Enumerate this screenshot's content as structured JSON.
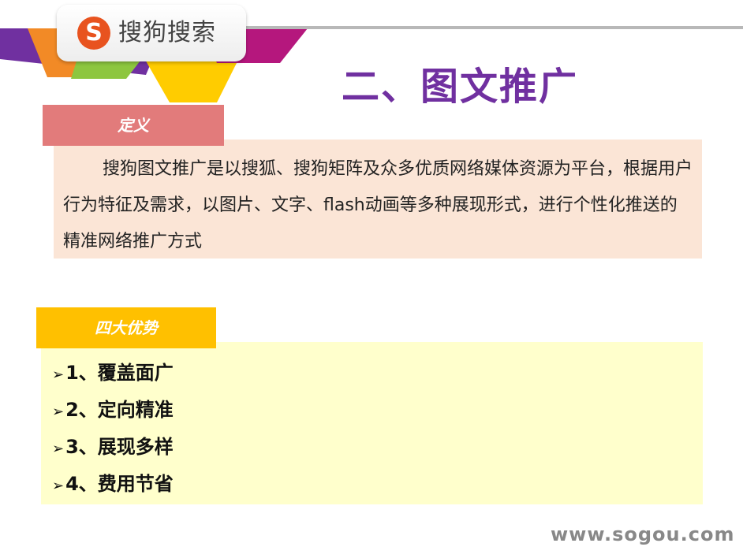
{
  "logo": {
    "mark": "S",
    "text": "搜狗搜索"
  },
  "title": "二、图文推广",
  "definition": {
    "label": "定义",
    "text": "搜狗图文推广是以搜狐、搜狗矩阵及众多优质网络媒体资源为平台，根据用户行为特征及需求，以图片、文字、flash动画等多种展现形式，进行个性化推送的精准网络推广方式"
  },
  "advantages": {
    "label": "四大优势",
    "bullet_glyph": "➢",
    "items": [
      "1、覆盖面广",
      "2、定向精准",
      "3、展现多样",
      "4、费用节省"
    ]
  },
  "footer": {
    "url": "www.sogou.com"
  },
  "colors": {
    "title": "#7030a0",
    "definition_tag": "#e27b7b",
    "definition_box": "#fbe5d6",
    "advantages_tag": "#ffc000",
    "advantages_box": "#ffffcc",
    "logo_mark": "#e8531f"
  }
}
